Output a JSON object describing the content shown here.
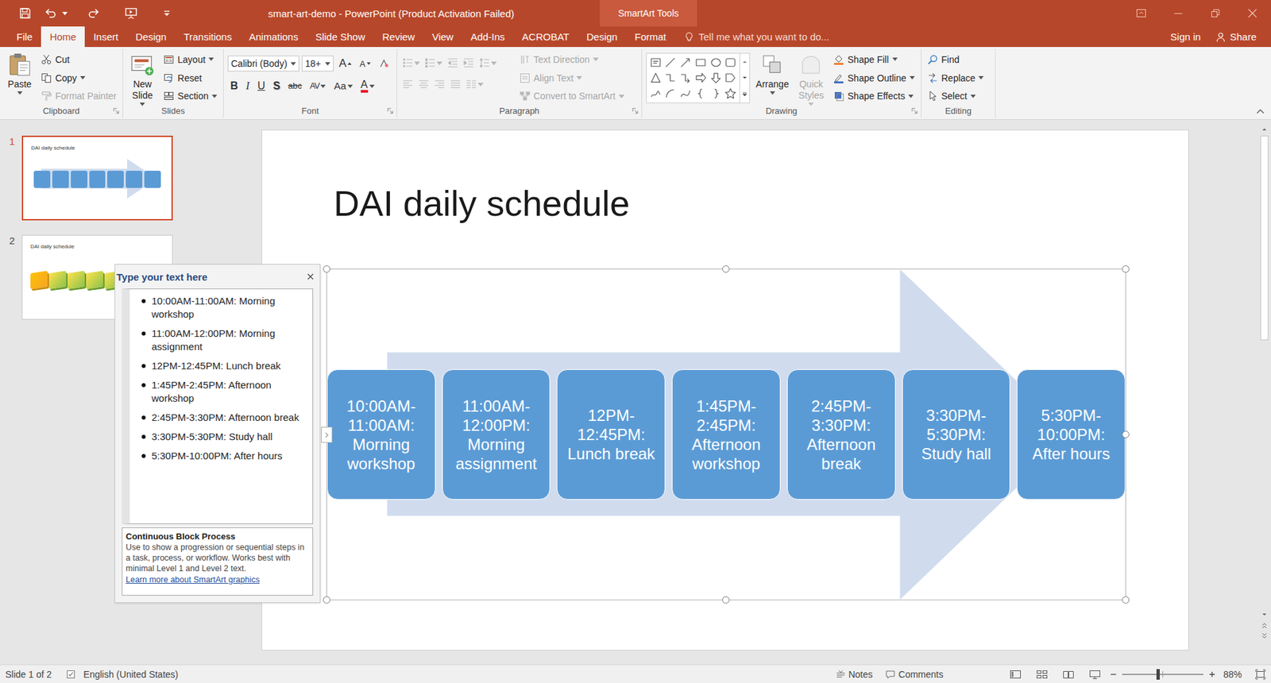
{
  "window": {
    "title": "smart-art-demo - PowerPoint (Product Activation Failed)",
    "context_group": "SmartArt Tools"
  },
  "tabs": [
    {
      "label": "File",
      "selected": false
    },
    {
      "label": "Home",
      "selected": true
    },
    {
      "label": "Insert",
      "selected": false
    },
    {
      "label": "Design",
      "selected": false
    },
    {
      "label": "Transitions",
      "selected": false
    },
    {
      "label": "Animations",
      "selected": false
    },
    {
      "label": "Slide Show",
      "selected": false
    },
    {
      "label": "Review",
      "selected": false
    },
    {
      "label": "View",
      "selected": false
    },
    {
      "label": "Add-Ins",
      "selected": false
    },
    {
      "label": "ACROBAT",
      "selected": false
    },
    {
      "label": "Design",
      "selected": false
    },
    {
      "label": "Format",
      "selected": false
    }
  ],
  "tell_me": {
    "placeholder": "Tell me what you want to do..."
  },
  "account": {
    "sign_in": "Sign in",
    "share": "Share"
  },
  "ribbon": {
    "clipboard": {
      "label": "Clipboard",
      "paste": "Paste",
      "items": [
        {
          "label": "Cut",
          "kind": "cut",
          "disabled": false,
          "dropdown": false
        },
        {
          "label": "Copy",
          "kind": "copy",
          "disabled": false,
          "dropdown": true
        },
        {
          "label": "Format Painter",
          "kind": "painter",
          "disabled": true,
          "dropdown": false
        }
      ]
    },
    "slides": {
      "label": "Slides",
      "new_slide": "New Slide",
      "items": [
        {
          "label": "Layout",
          "kind": "layout",
          "dropdown": true
        },
        {
          "label": "Reset",
          "kind": "reset",
          "dropdown": false
        },
        {
          "label": "Section",
          "kind": "section",
          "dropdown": true
        }
      ]
    },
    "font": {
      "label": "Font",
      "family": "Calibri (Body)",
      "size": "18+",
      "grow": "A",
      "shrink": "A",
      "styles": [
        {
          "glyph": "B",
          "kind": "bold",
          "dropdown": false
        },
        {
          "glyph": "I",
          "kind": "italic",
          "dropdown": false
        },
        {
          "glyph": "U",
          "kind": "underline",
          "dropdown": false
        },
        {
          "glyph": "S",
          "kind": "shadow",
          "dropdown": false
        },
        {
          "glyph": "abc",
          "kind": "strike",
          "dropdown": false
        },
        {
          "glyph": "AV",
          "kind": "spacing",
          "dropdown": true
        },
        {
          "glyph": "Aa",
          "kind": "case",
          "dropdown": true
        },
        {
          "glyph": "A",
          "kind": "color",
          "dropdown": true,
          "color": "#e81123"
        }
      ]
    },
    "paragraph": {
      "label": "Paragraph",
      "disabled": true,
      "commands": [
        {
          "label": "Text Direction",
          "kind": "direction",
          "disabled": true
        },
        {
          "label": "Align Text",
          "kind": "align",
          "disabled": true
        },
        {
          "label": "Convert to SmartArt",
          "kind": "convert",
          "disabled": true
        }
      ]
    },
    "drawing": {
      "label": "Drawing",
      "arrange": "Arrange",
      "quick_styles": {
        "label": "Quick Styles",
        "disabled": true
      },
      "items": [
        {
          "label": "Shape Fill",
          "kind": "fill",
          "color": "#ed7d31"
        },
        {
          "label": "Shape Outline",
          "kind": "outline",
          "color": "#4472c4"
        },
        {
          "label": "Shape Effects",
          "kind": "effects",
          "color": "#4472c4"
        }
      ]
    },
    "editing": {
      "label": "Editing",
      "items": [
        {
          "label": "Find",
          "kind": "find",
          "dropdown": false
        },
        {
          "label": "Replace",
          "kind": "replace",
          "dropdown": true
        },
        {
          "label": "Select",
          "kind": "select",
          "dropdown": true
        }
      ]
    }
  },
  "slides": [
    {
      "number": "1",
      "title": "DAI daily schedule",
      "selected": true,
      "kind": "process"
    },
    {
      "number": "2",
      "title": "DAI daily schedule",
      "selected": false,
      "kind": "blocks"
    }
  ],
  "slide": {
    "title": "DAI daily schedule"
  },
  "steps": [
    "10:00AM-11:00AM: Morning workshop",
    "11:00AM-12:00PM: Morning assignment",
    "12PM-12:45PM: Lunch break",
    "1:45PM-2:45PM: Afternoon workshop",
    "2:45PM-3:30PM: Afternoon break",
    "3:30PM-5:30PM: Study hall",
    "5:30PM-10:00PM: After hours"
  ],
  "text_pane": {
    "title": "Type your text here",
    "layout_name": "Continuous Block Process",
    "description": "Use to show a progression or sequential steps in a task, process, or workflow. Works best with minimal Level 1 and Level 2 text.",
    "link": "Learn more about SmartArt graphics"
  },
  "status_bar": {
    "slide": "Slide 1 of 2",
    "language": "English (United States)",
    "notes": "Notes",
    "comments": "Comments",
    "zoom": "88%",
    "zoom_level": 0.44
  },
  "vertical_scrollbar": {
    "level": 0.43
  }
}
